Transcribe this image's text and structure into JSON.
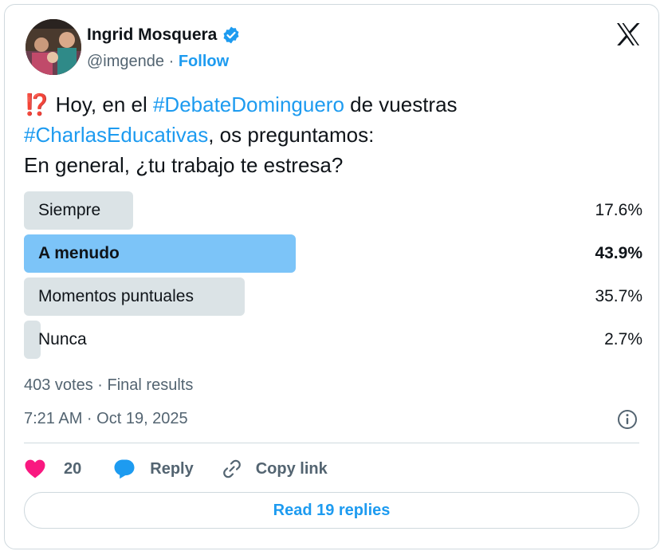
{
  "author": {
    "name": "Ingrid Mosquera",
    "handle": "@imgende",
    "separator": "·",
    "follow_label": "Follow",
    "verified_icon": "verified-badge-icon"
  },
  "tweet": {
    "emoji": "⁉️",
    "line1_pre": " Hoy, en el ",
    "hashtag1": "#DebateDominguero",
    "line1_post": " de vuestras",
    "hashtag2": "#CharlasEducativas",
    "line2_post": ", os preguntamos:",
    "line3": "En general, ¿tu trabajo te estresa?"
  },
  "poll": {
    "options": [
      {
        "label": "Siempre",
        "percent_text": "17.6%",
        "percent": 17.6,
        "winner": false
      },
      {
        "label": "A menudo",
        "percent_text": "43.9%",
        "percent": 43.9,
        "winner": true
      },
      {
        "label": "Momentos puntuales",
        "percent_text": "35.7%",
        "percent": 35.7,
        "winner": false
      },
      {
        "label": "Nunca",
        "percent_text": "2.7%",
        "percent": 2.7,
        "winner": false
      }
    ],
    "summary": "403 votes · Final results"
  },
  "timestamp": "7:21 AM · Oct 19, 2025",
  "actions": {
    "like_count": "20",
    "reply_label": "Reply",
    "copy_link_label": "Copy link"
  },
  "read_replies_label": "Read 19 replies",
  "colors": {
    "accent": "#1d9bf0",
    "like": "#f91880",
    "winner_bar": "#7cc4f8",
    "bar": "#cfd9de"
  }
}
